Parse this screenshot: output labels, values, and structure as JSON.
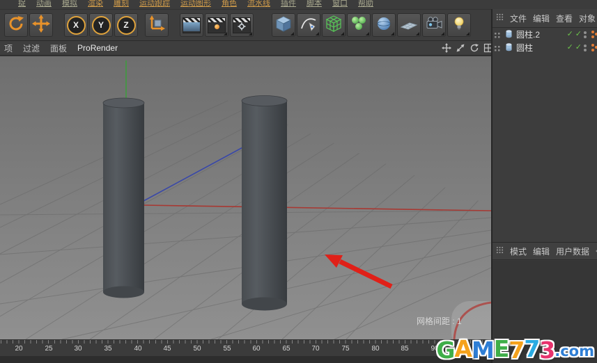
{
  "menubar": {
    "items": [
      "捉",
      "动画",
      "模拟",
      "渲染",
      "雕刻",
      "运动跟踪",
      "运动图形",
      "角色",
      "流水线",
      "插件",
      "脚本",
      "窗口",
      "帮助"
    ]
  },
  "toolbar": {
    "axis_locks": [
      "X",
      "Y",
      "Z"
    ],
    "tools": [
      "rotate-tool",
      "move-tool",
      "lock-x",
      "lock-y",
      "lock-z",
      "coordinate-system",
      "render-view",
      "render-picture-viewer",
      "render-settings",
      "cube-primitive",
      "pen-spline",
      "subdivision-surface",
      "cloner",
      "deformer",
      "floor-plane",
      "camera",
      "light"
    ]
  },
  "viewport": {
    "menus": [
      "项",
      "过滤",
      "面板",
      "ProRender"
    ],
    "nav_icons": [
      "pan-icon",
      "dolly-icon",
      "rotate-view-icon",
      "maximize-icon"
    ],
    "grid_spacing_label": "网格间距 : 1",
    "scene_objects": [
      "cylinder-left",
      "cylinder-right"
    ]
  },
  "object_manager": {
    "menus": [
      "文件",
      "编辑",
      "查看",
      "对象"
    ],
    "objects": [
      {
        "name": "圆柱.2"
      },
      {
        "name": "圆柱"
      }
    ]
  },
  "attribute_manager": {
    "menus": [
      "模式",
      "编辑",
      "用户数据"
    ]
  },
  "timeline": {
    "ticks": [
      "20",
      "25",
      "30",
      "35",
      "40",
      "45",
      "50",
      "55",
      "60",
      "65",
      "70",
      "75",
      "80",
      "85",
      "90"
    ]
  },
  "watermark": {
    "letters": [
      {
        "ch": "G",
        "color": "#3fae49"
      },
      {
        "ch": "A",
        "color": "#f5a21c"
      },
      {
        "ch": "M",
        "color": "#2e7ed5"
      },
      {
        "ch": "E",
        "color": "#3fae49"
      },
      {
        "ch": "7",
        "color": "#f5a21c"
      },
      {
        "ch": "7",
        "color": "#29abe2"
      },
      {
        "ch": "3",
        "color": "#e8336d"
      },
      {
        "ch": ".com",
        "color": "#2e7ed5"
      }
    ]
  },
  "icons": {
    "check": "✓"
  },
  "colors": {
    "accent_orange": "#e8922a",
    "axis_red": "#a83832",
    "axis_green": "#3f9b3f",
    "axis_blue": "#3948a8",
    "check_green": "#6cc24a",
    "arrow_red": "#e02018"
  }
}
